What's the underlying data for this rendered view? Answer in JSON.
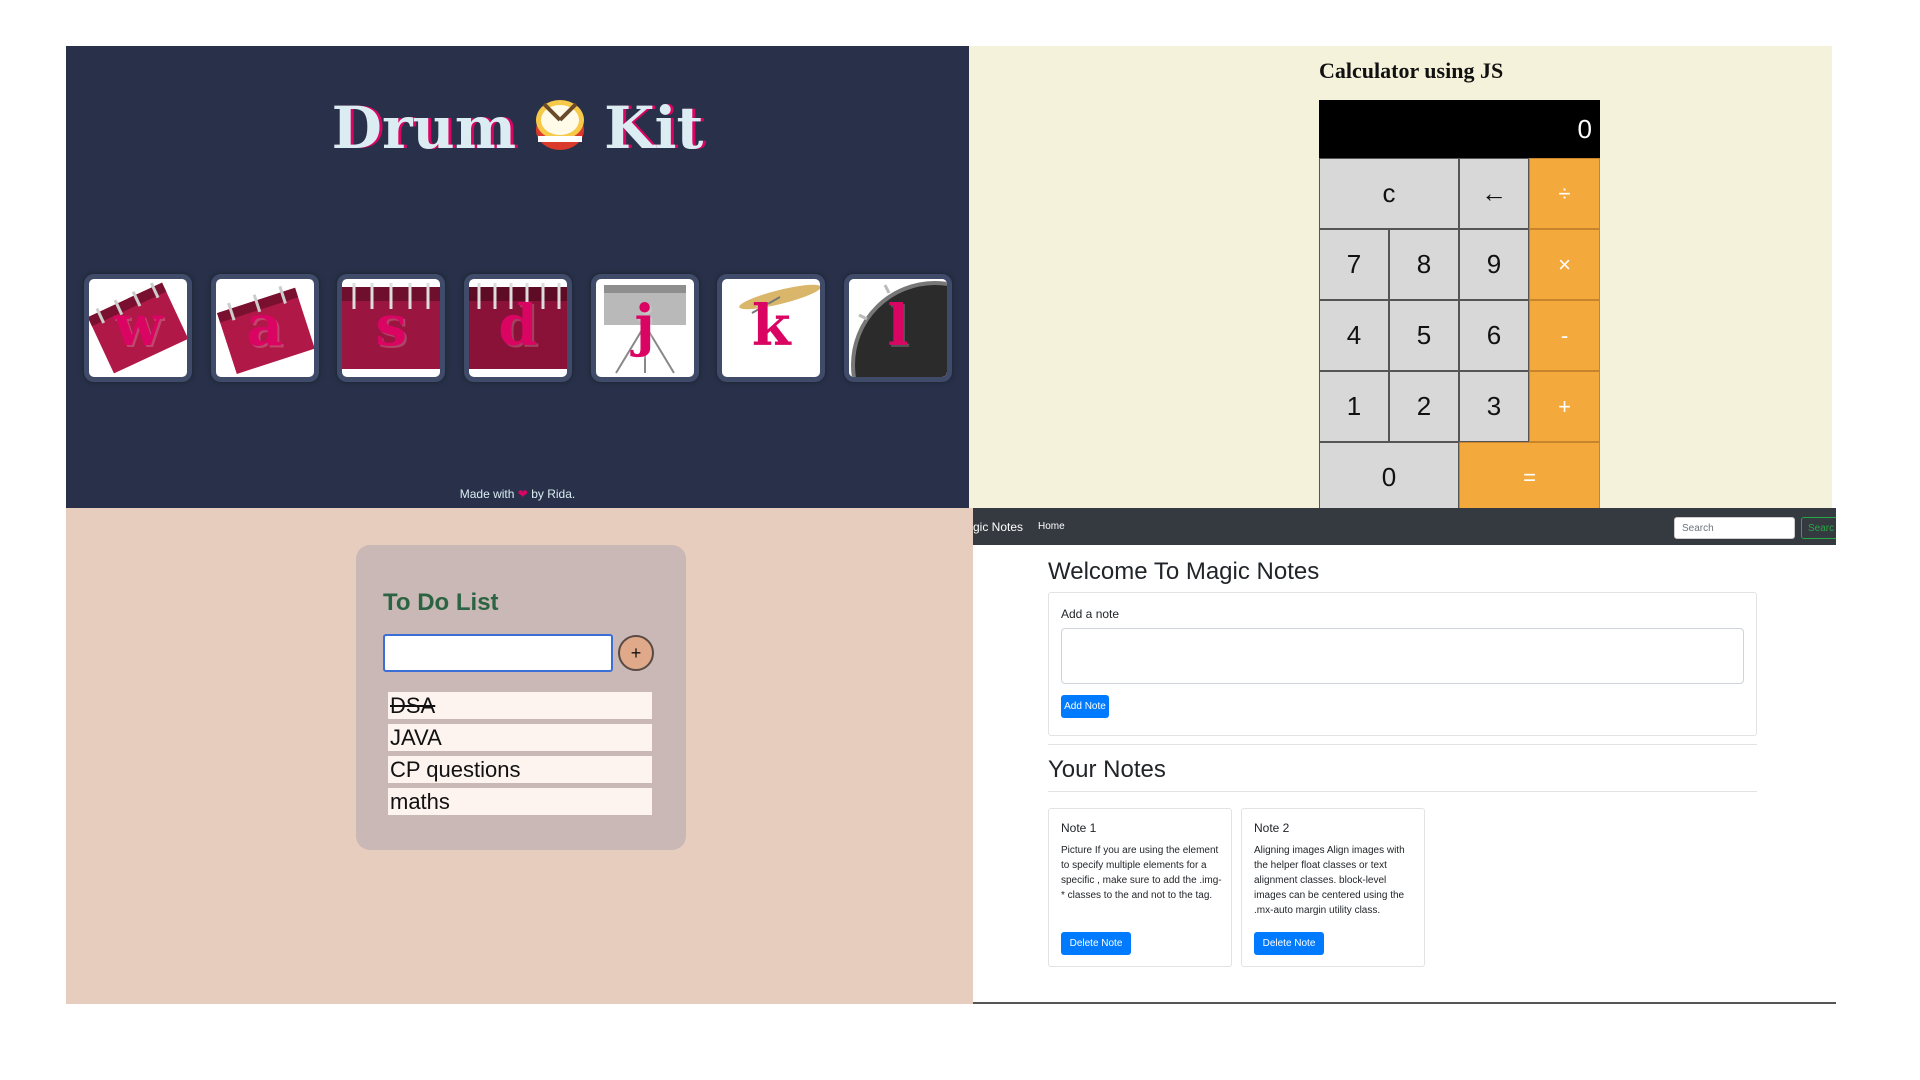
{
  "drum_kit": {
    "title_left": "Drum",
    "title_right": "Kit",
    "keys": [
      "w",
      "a",
      "s",
      "d",
      "j",
      "k",
      "l"
    ],
    "footer_before": "Made with",
    "footer_after": "by Rida."
  },
  "calculator": {
    "title": "Calculator using JS",
    "display": "0",
    "buttons": [
      "c",
      "←",
      "÷",
      "7",
      "8",
      "9",
      "×",
      "4",
      "5",
      "6",
      "-",
      "1",
      "2",
      "3",
      "+",
      "0",
      "="
    ]
  },
  "todo": {
    "title": "To Do List",
    "add_label": "+",
    "items": [
      "DSA",
      "JAVA",
      "CP questions",
      "maths"
    ]
  },
  "magic_notes": {
    "brand": "gic Notes",
    "nav_home": "Home",
    "search_placeholder": "Search",
    "search_button": "Searc",
    "heading": "Welcome To Magic Notes",
    "add_label": "Add a note",
    "add_button": "Add Note",
    "your_notes": "Your Notes",
    "notes": [
      {
        "title": "Note 1",
        "text": "Picture If you are using the element to specify multiple elements for a specific , make sure to add the .img-* classes to the  and not to the tag."
      },
      {
        "title": "Note 2",
        "text": "Aligning images Align images with the helper float classes or text alignment classes. block-level images can be centered using the .mx-auto margin utility class."
      }
    ],
    "delete_button": "Delete Note"
  },
  "colors": {
    "drum_bg": "#283149",
    "drum_accent": "#DA0463",
    "calc_bg": "#f4f2da",
    "calc_operator": "#f4a93c",
    "todo_bg": "#e7cdbd",
    "notes_primary": "#007bff"
  }
}
